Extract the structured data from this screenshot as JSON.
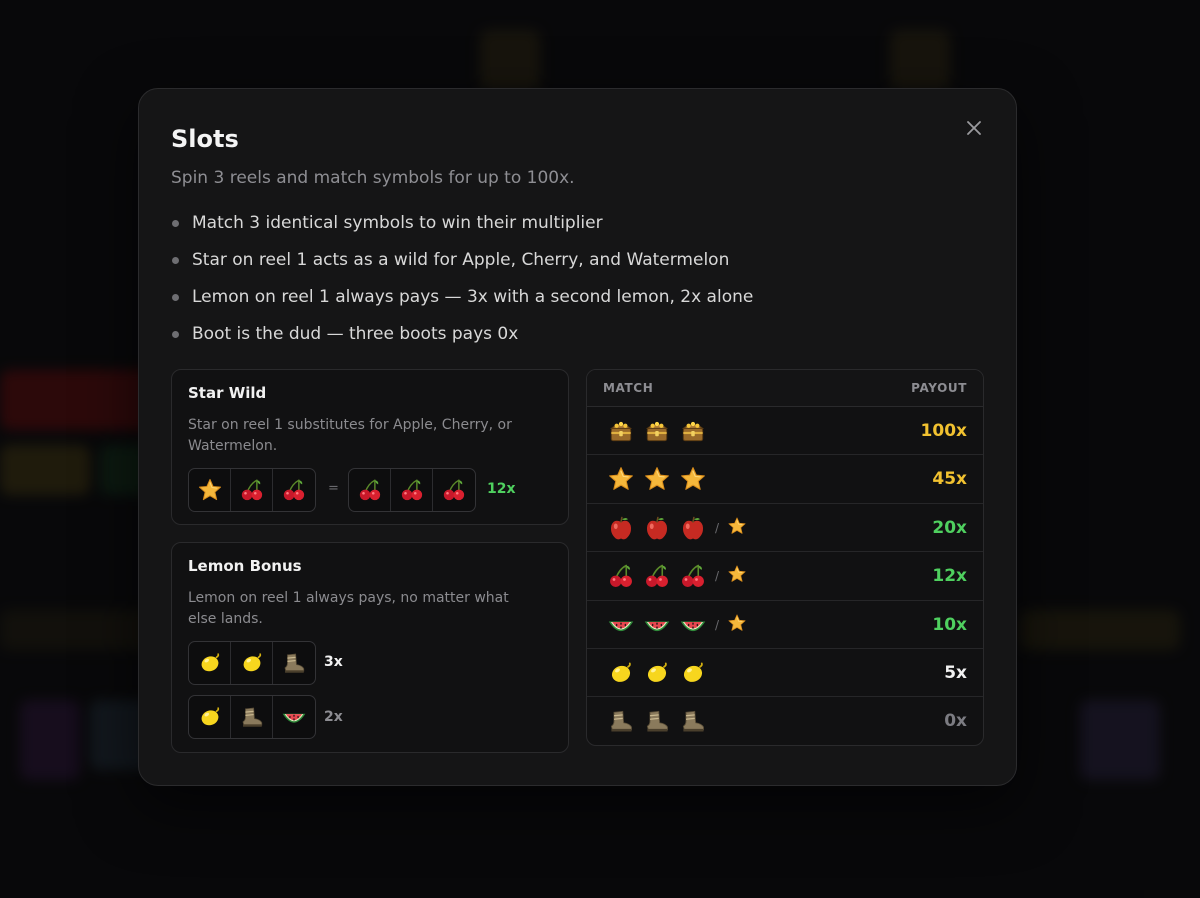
{
  "modal": {
    "title": "Slots",
    "subtitle": "Spin 3 reels and match symbols for up to 100x.",
    "close_icon": "close-icon",
    "rules": [
      "Match 3 identical symbols to win their multiplier",
      "Star on reel 1 acts as a wild for Apple, Cherry, and Watermelon",
      "Lemon on reel 1 always pays — 3x with a second lemon, 2x alone",
      "Boot is the dud — three boots pays 0x"
    ]
  },
  "star_wild": {
    "title": "Star Wild",
    "description": "Star on reel 1 substitutes for Apple, Cherry, or Watermelon.",
    "left_reels": [
      "star",
      "cherry",
      "cherry"
    ],
    "equals": "=",
    "right_reels": [
      "cherry",
      "cherry",
      "cherry"
    ],
    "multiplier": "12x"
  },
  "lemon_bonus": {
    "title": "Lemon Bonus",
    "description": "Lemon on reel 1 always pays, no matter what else lands.",
    "examples": [
      {
        "reels": [
          "lemon",
          "lemon",
          "boot"
        ],
        "multiplier": "3x"
      },
      {
        "reels": [
          "lemon",
          "boot",
          "watermelon"
        ],
        "multiplier": "2x"
      }
    ]
  },
  "paytable": {
    "header_match": "MATCH",
    "header_payout": "PAYOUT",
    "rows": [
      {
        "symbols": [
          "chest",
          "chest",
          "chest"
        ],
        "wild": false,
        "payout": "100x",
        "color": "#f2c230"
      },
      {
        "symbols": [
          "star",
          "star",
          "star"
        ],
        "wild": false,
        "payout": "45x",
        "color": "#f2c230"
      },
      {
        "symbols": [
          "apple",
          "apple",
          "apple"
        ],
        "wild": true,
        "payout": "20x",
        "color": "#4fd05f"
      },
      {
        "symbols": [
          "cherry",
          "cherry",
          "cherry"
        ],
        "wild": true,
        "payout": "12x",
        "color": "#4fd05f"
      },
      {
        "symbols": [
          "watermelon",
          "watermelon",
          "watermelon"
        ],
        "wild": true,
        "payout": "10x",
        "color": "#4fd05f"
      },
      {
        "symbols": [
          "lemon",
          "lemon",
          "lemon"
        ],
        "wild": false,
        "payout": "5x",
        "color": "#f2f2f2"
      },
      {
        "symbols": [
          "boot",
          "boot",
          "boot"
        ],
        "wild": false,
        "payout": "0x",
        "color": "#7c7c82"
      }
    ],
    "wild_separator": "/"
  },
  "colors": {
    "green": "#4fd05f",
    "gold": "#f2c230",
    "neutral": "#f2f2f2",
    "muted": "#7c7c82"
  }
}
